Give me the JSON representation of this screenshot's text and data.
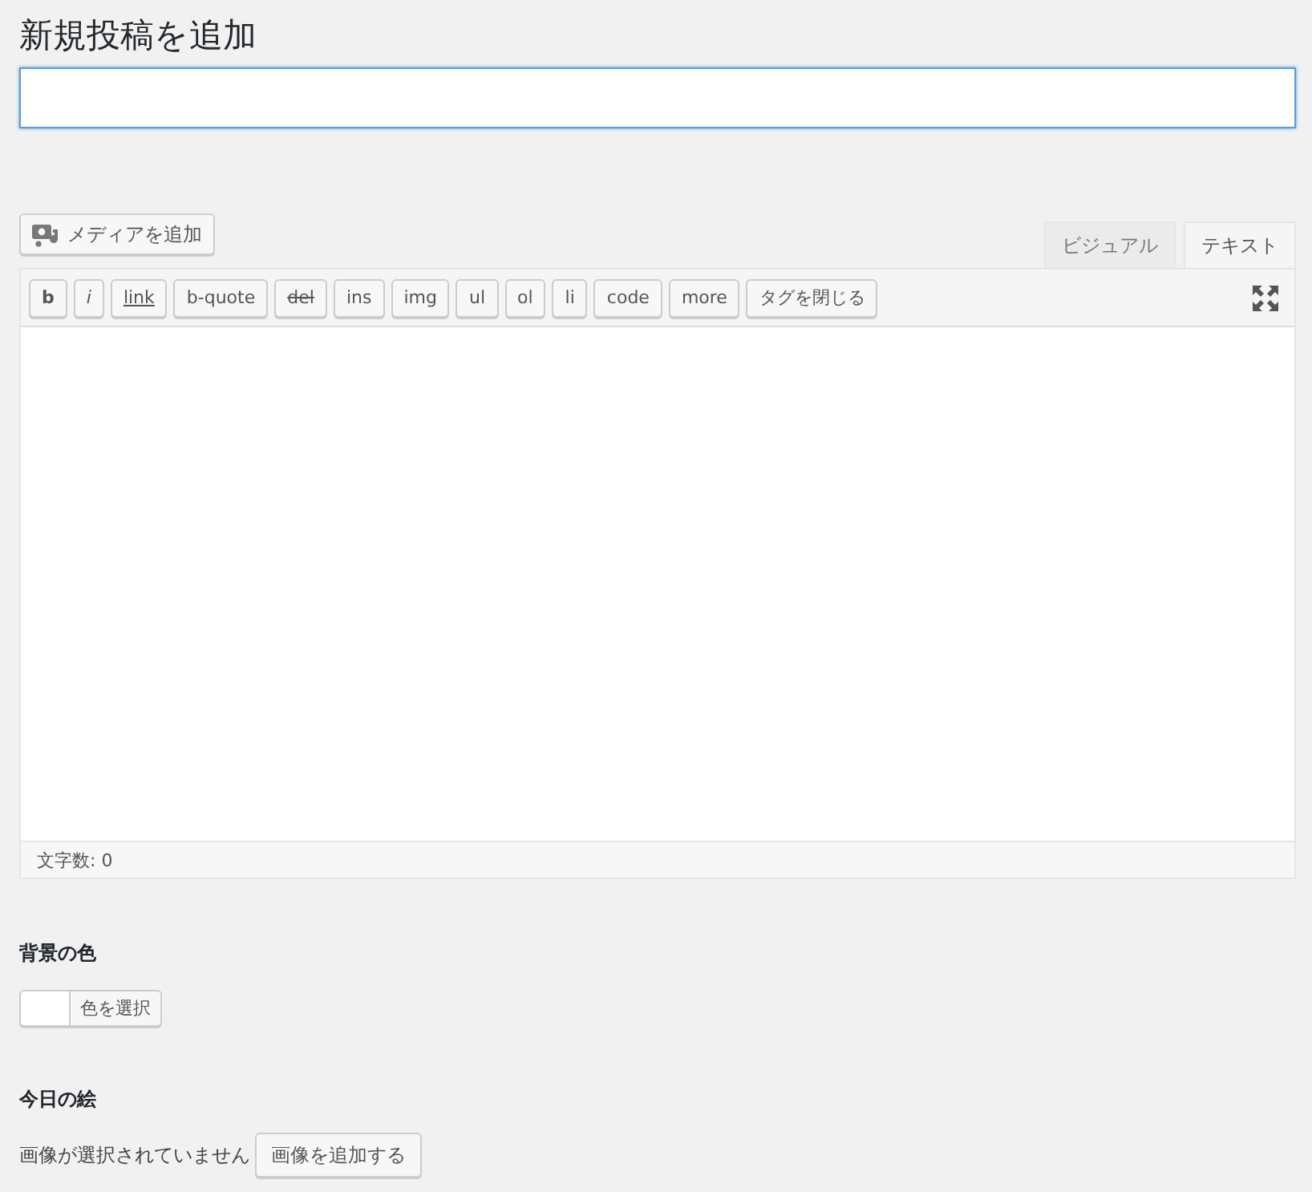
{
  "heading": "新規投稿を追加",
  "title_field": {
    "focused": true
  },
  "media_button": "メディアを追加",
  "tabs": [
    {
      "label": "ビジュアル",
      "selected": false
    },
    {
      "label": "テキスト",
      "selected": true
    }
  ],
  "quicktags": [
    {
      "label": "b",
      "kind": "bold"
    },
    {
      "label": "i",
      "kind": "italic"
    },
    {
      "label": "link",
      "kind": "link"
    },
    {
      "label": "b-quote",
      "kind": "plain"
    },
    {
      "label": "del",
      "kind": "strike"
    },
    {
      "label": "ins",
      "kind": "plain"
    },
    {
      "label": "img",
      "kind": "plain"
    },
    {
      "label": "ul",
      "kind": "plain"
    },
    {
      "label": "ol",
      "kind": "plain"
    },
    {
      "label": "li",
      "kind": "plain"
    },
    {
      "label": "code",
      "kind": "plain"
    },
    {
      "label": "more",
      "kind": "plain"
    },
    {
      "label": "タグを閉じる",
      "kind": "plain"
    }
  ],
  "word_count": "文字数: 0",
  "background_color": {
    "label": "背景の色",
    "button": "色を選択"
  },
  "picture_of_day": {
    "label": "今日の絵",
    "status": "画像が選択されていません",
    "button": "画像を追加する"
  }
}
